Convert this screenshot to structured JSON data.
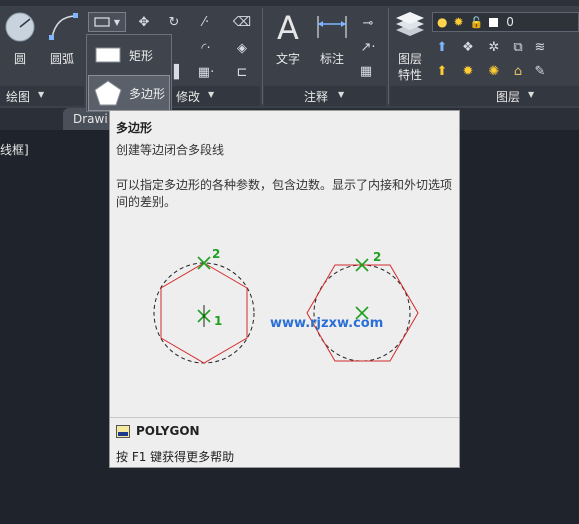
{
  "ribbon": {
    "tools": {
      "circle_label": "圆",
      "arc_label": "圆弧",
      "text_label": "文字",
      "dimension_label": "标注",
      "layer_props_label_1": "图层",
      "layer_props_label_2": "特性",
      "layer_count": "0"
    },
    "panels": {
      "draw": "绘图",
      "modify": "修改",
      "annotation": "注释",
      "layers": "图层"
    }
  },
  "tabs": {
    "drawing_tab": "Drawi"
  },
  "command_line_fragment": "线框]",
  "flyout": {
    "rectangle_label": "矩形",
    "polygon_label": "多边形"
  },
  "tooltip": {
    "title": "多边形",
    "description": "创建等边闭合多段线",
    "details": "可以指定多边形的各种参数，包含边数。显示了内接和外切选项间的差别。",
    "marker_1": "1",
    "marker_2_left": "2",
    "marker_2_right": "2",
    "watermark": "www.rjzxw.com",
    "command": "POLYGON",
    "help": "按 F1 键获得更多帮助"
  },
  "colors": {
    "ribbon_bg": "#3b4049",
    "canvas_bg": "#1f232b",
    "tooltip_bg": "#eeeeee",
    "polygon_red": "#d42a2a",
    "marker_green": "#20a020",
    "watermark_blue": "#2a6fd6"
  }
}
